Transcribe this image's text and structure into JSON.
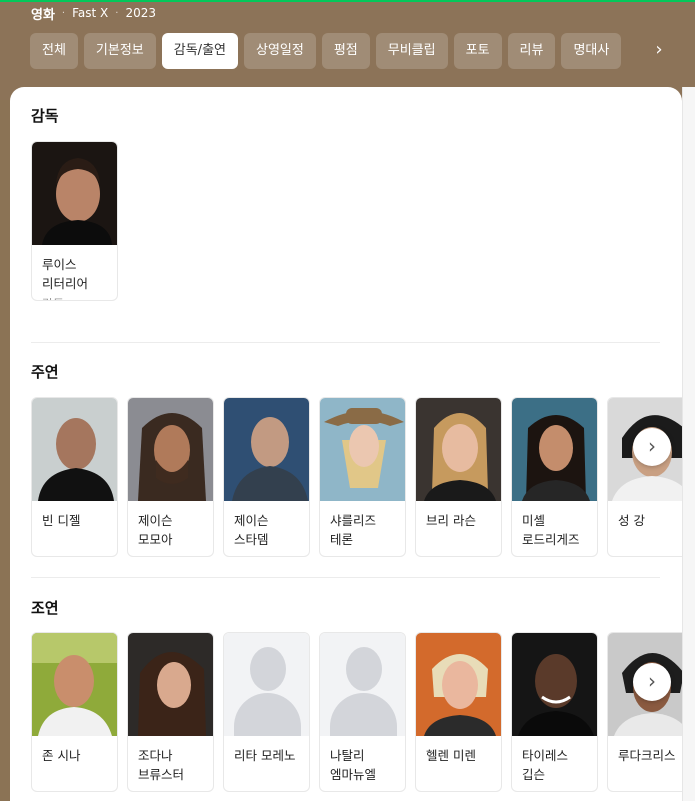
{
  "breadcrumb": {
    "category": "영화",
    "title": "Fast X",
    "year": "2023"
  },
  "tabs": [
    "전체",
    "기본정보",
    "감독/출연",
    "상영일정",
    "평점",
    "무비클립",
    "포토",
    "리뷰",
    "명대사"
  ],
  "active_tab": "감독/출연",
  "tab_next_icon": "chevron-right-icon",
  "sections": {
    "director": {
      "title": "감독",
      "people": [
        {
          "name": "루이스 리터리어",
          "role": "감독",
          "photo": "portrait"
        }
      ]
    },
    "main_cast": {
      "title": "주연",
      "people": [
        {
          "name": "빈 디젤"
        },
        {
          "name": "제이슨 모모아"
        },
        {
          "name": "제이슨 스타뎀"
        },
        {
          "name": "샤를리즈 테론"
        },
        {
          "name": "브리 라슨"
        },
        {
          "name": "미셸 로드리게즈"
        },
        {
          "name": "성 강"
        }
      ]
    },
    "supporting_cast": {
      "title": "조연",
      "people": [
        {
          "name": "존 시나"
        },
        {
          "name": "조다나 브류스터"
        },
        {
          "name": "리타 모레노",
          "placeholder": true
        },
        {
          "name": "나탈리 엠마뉴엘",
          "placeholder": true
        },
        {
          "name": "헬렌 미렌"
        },
        {
          "name": "타이레스 깁슨"
        },
        {
          "name": "루다크리스"
        }
      ]
    }
  },
  "colors": {
    "header_bg": "#8c7358",
    "accent_line": "#03c75a",
    "active_tab_bg": "#ffffff",
    "role_text": "#999999"
  }
}
